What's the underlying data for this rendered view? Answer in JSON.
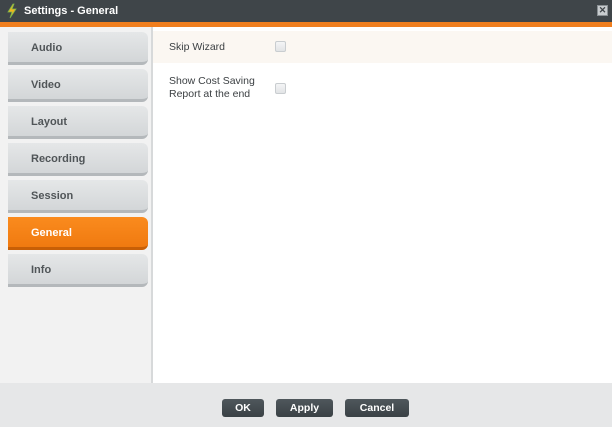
{
  "window": {
    "title": "Settings - General",
    "close_glyph": "✕",
    "app_icon": "app-logo-icon"
  },
  "colors": {
    "titlebar": "#3f4549",
    "accent": "#f07e1e",
    "active_tab": "#f7861a"
  },
  "sidebar": {
    "tabs": [
      {
        "label": "Audio"
      },
      {
        "label": "Video"
      },
      {
        "label": "Layout"
      },
      {
        "label": "Recording"
      },
      {
        "label": "Session"
      },
      {
        "label": "General",
        "active": true
      },
      {
        "label": "Info"
      }
    ]
  },
  "general": {
    "skip_wizard_label": "Skip Wizard",
    "skip_wizard_checked": false,
    "cost_report_label_line1": "Show Cost Saving",
    "cost_report_label_line2": "Report at the end",
    "cost_report_checked": false
  },
  "footer": {
    "ok_label": "OK",
    "apply_label": "Apply",
    "cancel_label": "Cancel"
  }
}
